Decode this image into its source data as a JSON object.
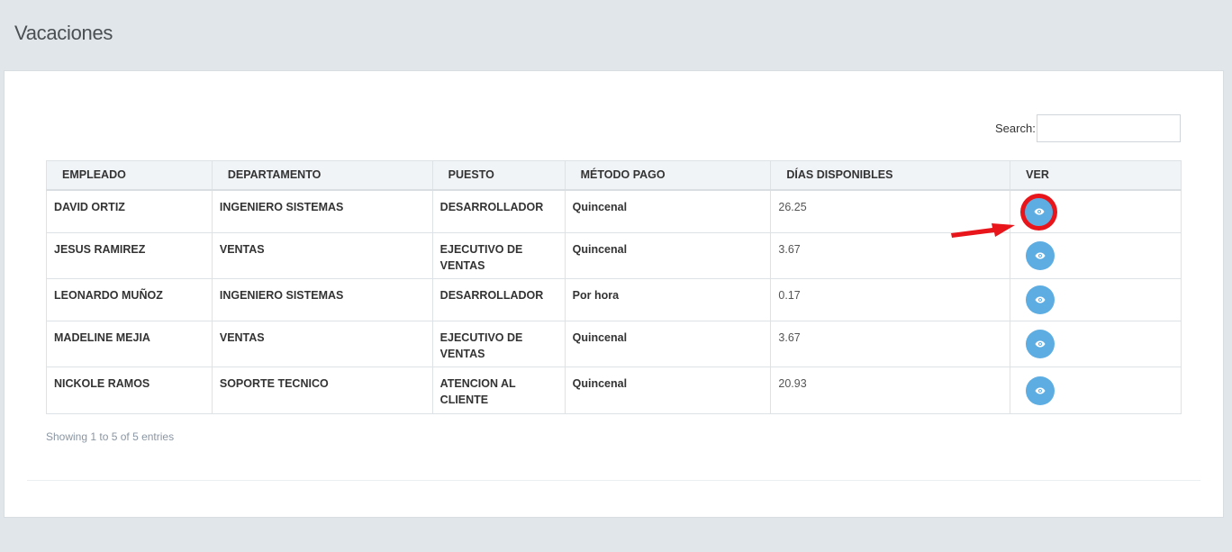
{
  "page": {
    "title": "Vacaciones"
  },
  "search": {
    "label": "Search:",
    "value": "",
    "placeholder": ""
  },
  "table": {
    "columns": [
      "EMPLEADO",
      "DEPARTAMENTO",
      "PUESTO",
      "MÉTODO PAGO",
      "DÍAS DISPONIBLES",
      "VER"
    ],
    "rows": [
      {
        "empleado": "DAVID ORTIZ",
        "departamento": "INGENIERO SISTEMAS",
        "puesto": "DESARROLLADOR",
        "metodo_pago": "Quincenal",
        "dias": "26.25"
      },
      {
        "empleado": "JESUS RAMIREZ",
        "departamento": "VENTAS",
        "puesto": "EJECUTIVO DE VENTAS",
        "metodo_pago": "Quincenal",
        "dias": "3.67"
      },
      {
        "empleado": "LEONARDO MUÑOZ",
        "departamento": "INGENIERO SISTEMAS",
        "puesto": "DESARROLLADOR",
        "metodo_pago": "Por hora",
        "dias": "0.17"
      },
      {
        "empleado": "MADELINE MEJIA",
        "departamento": "VENTAS",
        "puesto": "EJECUTIVO DE VENTAS",
        "metodo_pago": "Quincenal",
        "dias": "3.67"
      },
      {
        "empleado": "NICKOLE RAMOS",
        "departamento": "SOPORTE TECNICO",
        "puesto": "ATENCION AL CLIENTE",
        "metodo_pago": "Quincenal",
        "dias": "20.93"
      }
    ]
  },
  "footer": {
    "info": "Showing 1 to 5 of 5 entries"
  },
  "icons": {
    "view": "eye-icon",
    "annotation": "red-arrow-icon"
  },
  "colors": {
    "view_button": "#5dade2",
    "annotation": "#e8151b",
    "background": "#e1e6ea"
  }
}
